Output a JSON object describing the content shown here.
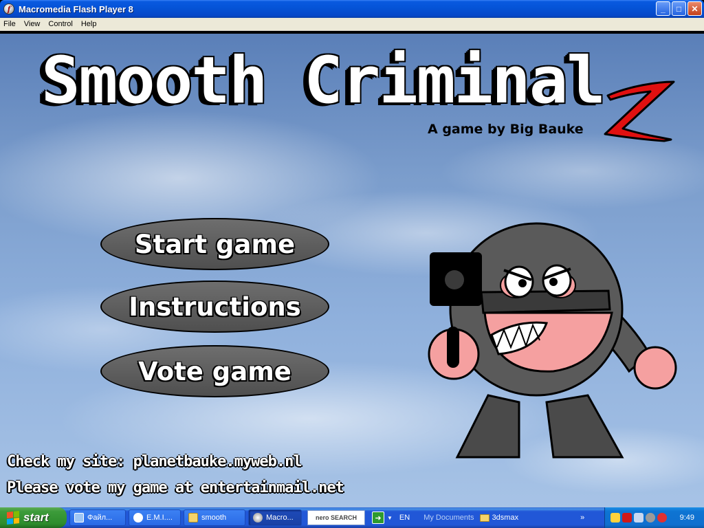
{
  "window": {
    "title": "Macromedia Flash Player 8",
    "icon": "flash-player-icon",
    "controls": {
      "minimize": "_",
      "maximize": "□",
      "close": "✕"
    }
  },
  "menubar": {
    "items": [
      {
        "label": "File"
      },
      {
        "label": "View"
      },
      {
        "label": "Control"
      },
      {
        "label": "Help"
      }
    ]
  },
  "game": {
    "title": "Smooth Criminal",
    "sequel_mark": "2",
    "byline": "A game by Big Bauke",
    "buttons": {
      "start": "Start game",
      "instructions": "Instructions",
      "vote": "Vote game"
    },
    "footer": {
      "line1": "Check my site: planetbauke.myweb.nl",
      "line2": "Please vote my game at entertainmail.net"
    },
    "colors": {
      "button_fill": "#5f5f5f",
      "character_body": "#5a5a5a",
      "character_skin": "#f5a0a0",
      "sequel_accent": "#e01010"
    }
  },
  "taskbar": {
    "start_label": "start",
    "tasks": [
      {
        "label": "Файл...",
        "icon": "explorer-icon"
      },
      {
        "label": "E.M.I....",
        "icon": "chat-icon"
      },
      {
        "label": "smooth",
        "icon": "folder-icon"
      },
      {
        "label": "Macro...",
        "icon": "flash-player-icon",
        "active": true
      }
    ],
    "nero_label": "nero SEARCH",
    "go_label": "➜",
    "dropdown": "▼",
    "language": "EN",
    "quick_link": "My Documents",
    "folder_link": "3dsmax",
    "overflow": "»",
    "clock": "9:49"
  }
}
